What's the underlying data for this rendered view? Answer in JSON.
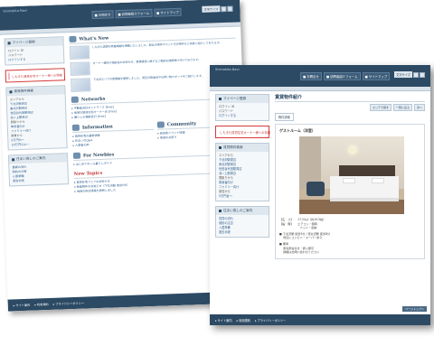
{
  "back": {
    "logo": "しもきたナビ",
    "logo_sub": "Shimokita-Navi",
    "topnav": [
      "■ お問合せ",
      "■ 訪問者紹介フォーム",
      "■ サイトマップ"
    ],
    "size_label": "文字サイズ",
    "left": {
      "my_title": "マイページ登録",
      "my_lines": [
        "ログイン ID",
        "パスワード",
        "ログインする"
      ],
      "banner_text": "しもきた賃貸住宅オーナー様への情報",
      "search_title": "賃貸物件検索",
      "groups": [
        {
          "label": "エリアから",
          "links": [
            "下北沢駅周辺",
            "東北沢駅周辺",
            "世田谷代田駅周辺",
            "池ノ上駅周辺"
          ]
        },
        {
          "label": "間取りから",
          "links": [
            "単身者向け",
            "ファミリー向け"
          ]
        },
        {
          "label": "家賃から",
          "links": [
            "5万円台〜",
            "10万円以上〜"
          ]
        }
      ],
      "guide_title": "住まい探しのご案内",
      "guide_links": [
        "賃貸の流れ",
        "契約の注意",
        "入居準備",
        "退去手続"
      ]
    },
    "main": {
      "s1_title": "What's New",
      "s1_items": [
        "しもきた賃貸の新着情報を掲載いたしました。駅近の物件やペット可の物件など多数ご紹介しております。",
        "オーナー様向け相談会のお知らせ。賃貸経営に関するご相談を随時受け付けております。",
        "下北沢エリアの街情報を更新しました。周辺の飲食店やお買い物スポットをご紹介します。"
      ],
      "s2_title": "Networks",
      "s2_lines": [
        "▸ 不動産会社ネットワーク [Free]",
        "▸ 地域の賃貸住宅オーナー会 [Free]",
        "▸ 暮らしの相談窓口 [Free]"
      ],
      "s3a_title": "Information",
      "s3a_lines": [
        "▸ 賃貸住宅の最新情報",
        "▸ 住まいのQ&A",
        "▸ 入居者の声"
      ],
      "s3b_title": "Community",
      "s3b_lines": [
        "▸ 商店街イベント情報",
        "▸ 地域のお祭り"
      ],
      "s4_title": "For Newbies",
      "s4_lines": [
        "▸ はじめての一人暮らしガイド"
      ],
      "s5_title": "New Topics",
      "s5_lines": [
        "▸ 賃貸住宅フェアのお知らせ",
        "▸ 新着物件のお知らせ（下北沢駅 徒歩5分）",
        "▸ 地域の防災情報を更新しました"
      ]
    },
    "footer": [
      "▸ サイト案内",
      "▸ 利用規約",
      "▸ プライバシーポリシー"
    ]
  },
  "front": {
    "logo": "しもきたナビ",
    "logo_sub": "Shimokita-Navi",
    "topnav": [
      "■ お問合せ",
      "■ 訪問者紹介フォーム",
      "■ サイトマップ"
    ],
    "size_label": "文字サイズ",
    "left": {
      "my_title": "マイページ登録",
      "my_lines": [
        "ログイン ID",
        "パスワード",
        "ログインする"
      ],
      "banner_text": "しもきた賃貸住宅オーナー様への情報",
      "search_title": "賃貸物件検索",
      "groups": [
        {
          "label": "エリアから",
          "links": [
            "下北沢駅周辺",
            "東北沢駅周辺",
            "世田谷代田駅周辺",
            "池ノ上駅周辺"
          ]
        },
        {
          "label": "間取りから",
          "links": [
            "単身者向け",
            "ファミリー向け"
          ]
        },
        {
          "label": "家賃から",
          "links": [
            "5万円台〜"
          ]
        }
      ],
      "guide_title": "住まい探しのご案内",
      "guide_links": [
        "賃貸の流れ",
        "契約の注意",
        "入居準備",
        "退去手続"
      ]
    },
    "main": {
      "page_title": "賃貸物件紹介",
      "crumbs": [
        "エリアで探す",
        "一覧に戻る",
        "次へ"
      ],
      "tab": "物件詳細",
      "room_name": "ゲストルーム（洋室）",
      "details": [
        "【広　さ】　　17.24㎡（約10.5帖）",
        "【設　備】　　エアコン・照明",
        "　　　　　　　 ベッド・収納",
        "■ 下北沢駅 徒歩5分 / 東北沢駅 徒歩8分",
        "　 周辺にコンビニ・スーパーあり",
        "■ 備考",
        "　 家具家電付き・即入居可",
        "　 詳細はお問い合わせください"
      ],
      "page_button": "ページトップへ"
    },
    "footer": [
      "▸ サイト案内",
      "▸ 利用規約",
      "▸ プライバシーポリシー"
    ]
  }
}
